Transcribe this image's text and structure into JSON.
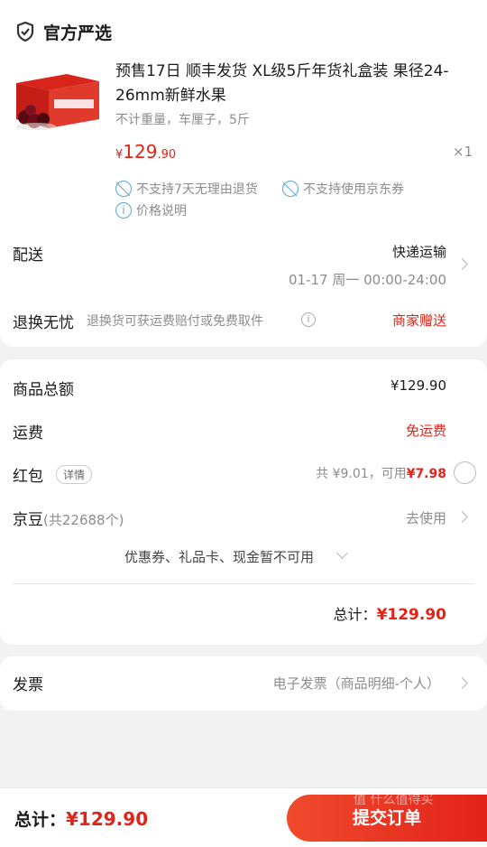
{
  "store": {
    "name": "官方严选"
  },
  "product": {
    "title_line1": "预售17日 顺丰发货 XL级5斤年货礼盒装 果径24-",
    "title_line2": "26mm新鲜水果",
    "spec": "不计重量，车厘子，5斤",
    "price_symbol": "¥",
    "price_int": "129",
    "price_dec": ".90",
    "quantity": "×1",
    "image_label": "CHERRIES",
    "notices": [
      "不支持7天无理由退货",
      "不支持使用京东券",
      "价格说明"
    ]
  },
  "delivery": {
    "label": "配送",
    "method": "快递运输",
    "time": "01-17 周一 00:00-24:00"
  },
  "returns": {
    "label": "退换无忧",
    "desc": "退换货可获运费赔付或免费取件",
    "value": "商家赠送"
  },
  "summary": {
    "goods_label": "商品总额",
    "goods_value": "¥129.90",
    "freight_label": "运费",
    "freight_value": "免运费",
    "redpack_label": "红包",
    "redpack_detail": "详情",
    "redpack_info": "共 ¥9.01，可用",
    "redpack_amount": "¥7.98",
    "jd_label": "京豆",
    "jd_count": "(共22688个)",
    "jd_value": "去使用",
    "unavailable": "优惠券、礼品卡、现金暂不可用",
    "total_label": "总计：",
    "total_value": "¥129.90"
  },
  "invoice": {
    "label": "发票",
    "value": "电子发票（商品明细-个人）"
  },
  "footer": {
    "total_label": "总计：",
    "total_value": "¥129.90",
    "submit_label": "提交订单",
    "watermark": "值 什么值得买"
  },
  "colors": {
    "accent": "#e2231a",
    "icon_blue": "#5ea4d6"
  }
}
